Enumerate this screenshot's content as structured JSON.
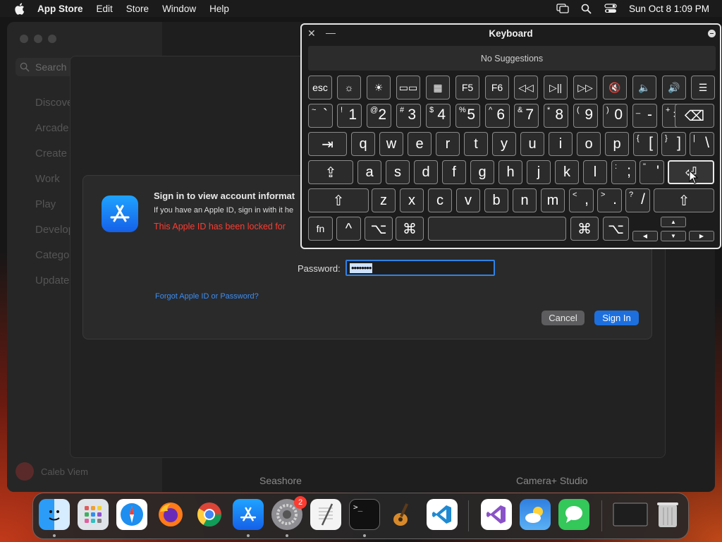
{
  "menubar": {
    "app": "App Store",
    "items": [
      "Edit",
      "Store",
      "Window",
      "Help"
    ],
    "clock": "Sun Oct 8  1:09 PM"
  },
  "sidebar": {
    "search_placeholder": "Search",
    "items": [
      "Discover",
      "Arcade",
      "Create",
      "Work",
      "Play",
      "Develop",
      "Categories",
      "Updates"
    ],
    "user": "Caleb Viem"
  },
  "main": {
    "bottom_labels": [
      "Seashore",
      "Camera+ Studio"
    ]
  },
  "dialog": {
    "title": "Sign in to view account informat",
    "subtitle": "If you have an Apple ID, sign in with it he",
    "error": "This Apple ID has been locked for",
    "password_label": "Password:",
    "password_value": "••••••••",
    "forgot_link": "Forgot Apple ID or Password?",
    "cancel": "Cancel",
    "sign_in": "Sign In"
  },
  "keyboard": {
    "title": "Keyboard",
    "suggestions": "No Suggestions",
    "fn_row": [
      "esc",
      "☼",
      "☀",
      "▭▭",
      "▦",
      "F5",
      "F6",
      "◁◁",
      "▷||",
      "▷▷",
      "🔇",
      "🔈",
      "🔊",
      "☰"
    ],
    "number_row": [
      {
        "top": "~",
        "main": "`"
      },
      {
        "top": "!",
        "main": "1"
      },
      {
        "top": "@",
        "main": "2"
      },
      {
        "top": "#",
        "main": "3"
      },
      {
        "top": "$",
        "main": "4"
      },
      {
        "top": "%",
        "main": "5"
      },
      {
        "top": "^",
        "main": "6"
      },
      {
        "top": "&",
        "main": "7"
      },
      {
        "top": "*",
        "main": "8"
      },
      {
        "top": "(",
        "main": "9"
      },
      {
        "top": ")",
        "main": "0"
      },
      {
        "top": "_",
        "main": "-"
      },
      {
        "top": "+",
        "main": "="
      }
    ],
    "backspace": "⌫",
    "tab": "⇥",
    "qwerty_row": [
      "q",
      "w",
      "e",
      "r",
      "t",
      "y",
      "u",
      "i",
      "o",
      "p"
    ],
    "qwerty_tail": [
      {
        "top": "{",
        "main": "["
      },
      {
        "top": "}",
        "main": "]"
      },
      {
        "top": "|",
        "main": "\\"
      }
    ],
    "caps": "⇪",
    "home_row": [
      "a",
      "s",
      "d",
      "f",
      "g",
      "h",
      "j",
      "k",
      "l"
    ],
    "home_tail": [
      {
        "top": ":",
        "main": ";"
      },
      {
        "top": "\"",
        "main": "'"
      }
    ],
    "enter": "⏎",
    "shift": "⇧",
    "bottom_letters": [
      "z",
      "x",
      "c",
      "v",
      "b",
      "n",
      "m"
    ],
    "bottom_tail": [
      {
        "top": "<",
        "main": ","
      },
      {
        "top": ">",
        "main": "."
      },
      {
        "top": "?",
        "main": "/"
      }
    ],
    "fn": "fn",
    "ctrl": "^",
    "opt": "⌥",
    "cmd": "⌘",
    "arrows": {
      "up": "▲",
      "left": "◀",
      "down": "▼",
      "right": "▶"
    }
  },
  "dock": {
    "settings_badge": "2"
  }
}
